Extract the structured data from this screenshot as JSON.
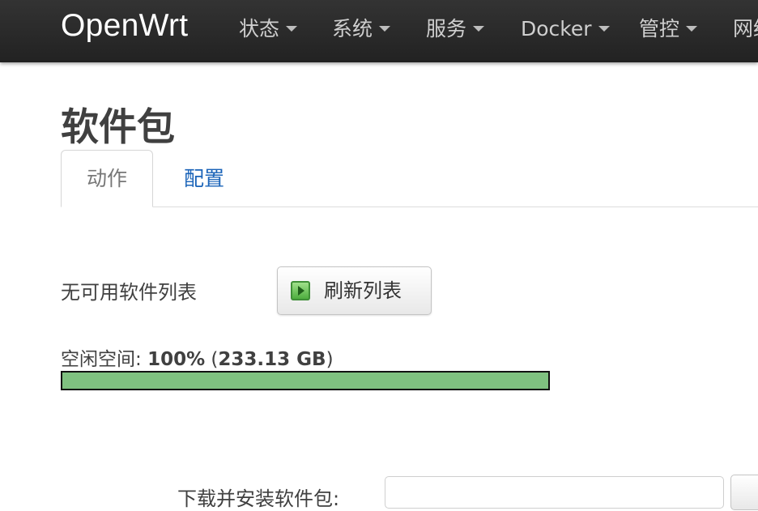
{
  "brand": "OpenWrt",
  "nav": [
    {
      "label": "状态"
    },
    {
      "label": "系统"
    },
    {
      "label": "服务"
    },
    {
      "label": "Docker"
    },
    {
      "label": "管控"
    },
    {
      "label": "网络"
    }
  ],
  "page": {
    "title": "软件包",
    "tabs": [
      {
        "label": "动作"
      },
      {
        "label": "配置"
      }
    ]
  },
  "actions": {
    "no_list_text": "无可用软件列表",
    "refresh_button": "刷新列表",
    "free_space_label": "空闲空间:",
    "free_space_percent": "100%",
    "free_space_size": "233.13 GB",
    "free_space_fraction": 1.0,
    "install_label": "下载并安装软件包:"
  },
  "colors": {
    "navbar": "#222222",
    "link": "#1a63b8",
    "progress": "#7fc180"
  },
  "icons": {
    "refresh": "play-icon",
    "dropdown": "chevron-down-icon"
  }
}
